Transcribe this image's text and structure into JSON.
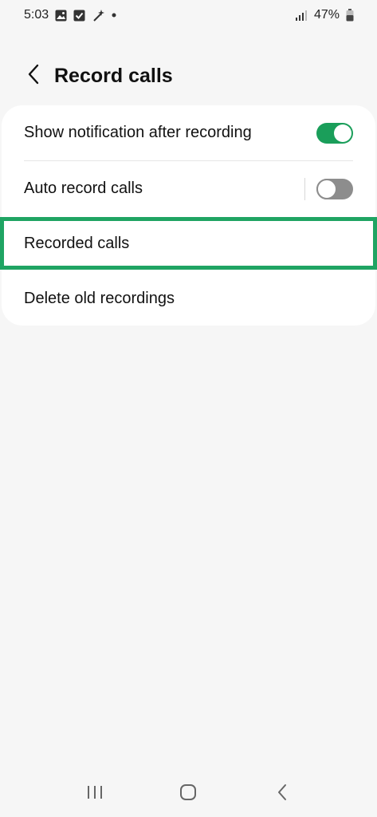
{
  "status_bar": {
    "time": "5:03",
    "battery": "47%",
    "icons": [
      "gallery-icon",
      "check-icon",
      "magic-wand-icon",
      "dot-icon",
      "signal-icon",
      "battery-icon"
    ]
  },
  "header": {
    "title": "Record calls",
    "back_icon": "back-arrow-icon"
  },
  "settings": {
    "items": [
      {
        "label": "Show notification after recording",
        "toggle": "on"
      },
      {
        "label": "Auto record calls",
        "toggle": "off"
      },
      {
        "label": "Recorded calls"
      },
      {
        "label": "Delete old recordings"
      }
    ]
  },
  "colors": {
    "accent": "#1a9e5a",
    "highlight": "#1fa463",
    "background": "#f6f6f6"
  },
  "nav_bar": {
    "icons": [
      "recent-apps-icon",
      "home-icon",
      "back-icon"
    ]
  }
}
